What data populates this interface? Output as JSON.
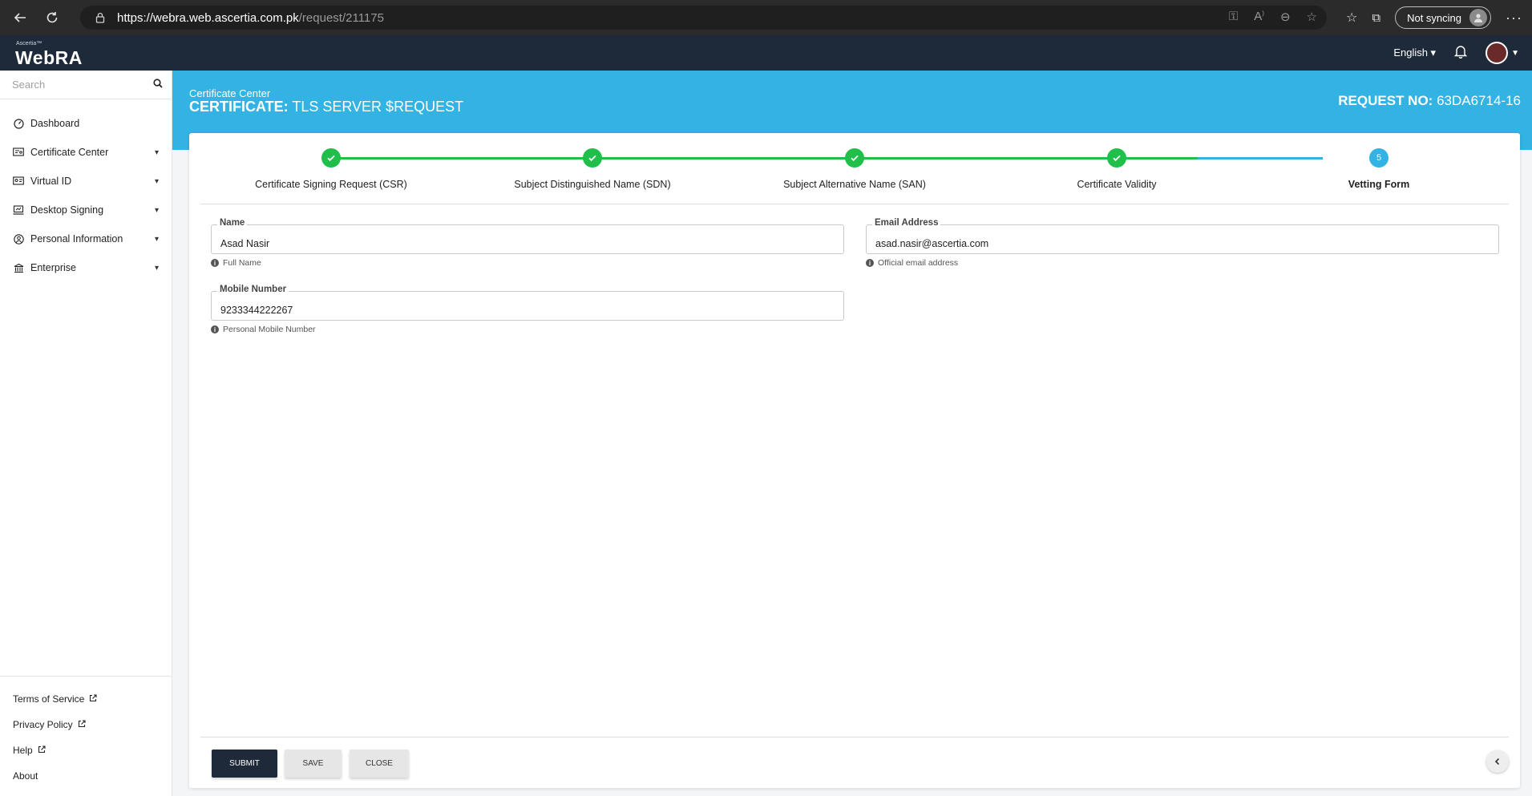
{
  "browser": {
    "url_host": "https://webra.web.ascertia.com.pk",
    "url_path": "/request/211175",
    "sync_label": "Not syncing",
    "icons": [
      "back-icon",
      "refresh-icon",
      "lock-icon",
      "key-icon",
      "read-aloud-icon",
      "zoom-icon",
      "add-favorite-icon",
      "favorites-icon",
      "collections-icon",
      "more-icon"
    ]
  },
  "header": {
    "brand_small": "Ascertia™",
    "brand": "WebRA",
    "language": "English ▾"
  },
  "sidebar": {
    "search_placeholder": "Search",
    "items": [
      {
        "label": "Dashboard",
        "icon": "dashboard-icon",
        "has_children": false
      },
      {
        "label": "Certificate Center",
        "icon": "certificate-icon",
        "has_children": true
      },
      {
        "label": "Virtual ID",
        "icon": "id-card-icon",
        "has_children": true
      },
      {
        "label": "Desktop Signing",
        "icon": "signing-icon",
        "has_children": true
      },
      {
        "label": "Personal Information",
        "icon": "person-icon",
        "has_children": true
      },
      {
        "label": "Enterprise",
        "icon": "building-icon",
        "has_children": true
      }
    ],
    "bottom_links": [
      {
        "label": "Terms of Service",
        "external": true
      },
      {
        "label": "Privacy Policy",
        "external": true
      },
      {
        "label": "Help",
        "external": true
      },
      {
        "label": "About",
        "external": false
      }
    ]
  },
  "page": {
    "breadcrumb": "Certificate Center",
    "title_prefix": "CERTIFICATE:",
    "title_value": "TLS SERVER $REQUEST",
    "request_label": "REQUEST NO:",
    "request_value": "63DA6714-16"
  },
  "stepper": {
    "steps": [
      {
        "label": "Certificate Signing Request (CSR)",
        "status": "complete"
      },
      {
        "label": "Subject Distinguished Name (SDN)",
        "status": "complete"
      },
      {
        "label": "Subject Alternative Name (SAN)",
        "status": "complete"
      },
      {
        "label": "Certificate Validity",
        "status": "complete"
      },
      {
        "label": "Vetting Form",
        "status": "active",
        "number": "5"
      }
    ],
    "colors": {
      "complete": "#1fbf4a",
      "active": "#33b3e3"
    }
  },
  "form": {
    "name": {
      "label": "Name",
      "value": "Asad Nasir",
      "hint": "Full Name"
    },
    "email": {
      "label": "Email Address",
      "value": "asad.nasir@ascertia.com",
      "hint": "Official email address"
    },
    "mobile": {
      "label": "Mobile Number",
      "value": "9233344222267",
      "hint": "Personal Mobile Number"
    }
  },
  "actions": {
    "submit": "SUBMIT",
    "save": "SAVE",
    "close": "CLOSE"
  },
  "colors": {
    "header_bg": "#1e2a3a",
    "accent_blue": "#33b3e3",
    "success_green": "#1fbf4a"
  }
}
